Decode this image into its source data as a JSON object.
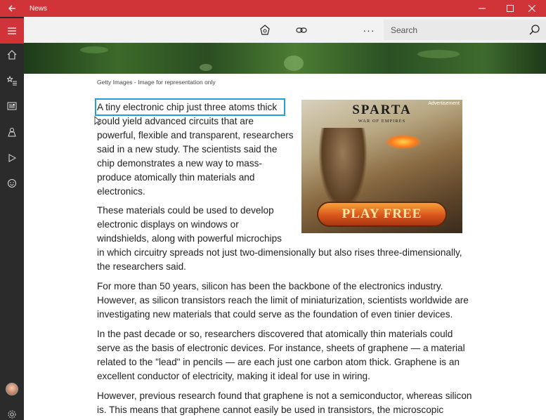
{
  "window": {
    "title": "News"
  },
  "toolbar": {
    "search_placeholder": "Search",
    "more_label": "···"
  },
  "icons": {
    "back": "back-arrow-icon",
    "minimize": "minimize-icon",
    "maximize": "maximize-icon",
    "close": "close-icon",
    "menu": "hamburger-icon",
    "home": "home-icon",
    "interests": "star-list-icon",
    "local": "newspaper-icon",
    "people": "person-icon",
    "video": "play-icon",
    "sports": "smiley-icon",
    "settings": "gear-icon",
    "save": "save-icon",
    "share": "link-icon",
    "night": "moon-icon",
    "search": "search-icon"
  },
  "colors": {
    "titlebar": "#d13438",
    "sidebar": "#2b2b2b",
    "highlight": "#1ea0dc"
  },
  "article": {
    "caption": "Getty Images - Image for representation only",
    "p1": [
      "A tiny electronic chip just three atoms thick",
      "could yield advanced circuits that are",
      "powerful, flexible and transparent, researchers",
      "said in a new study. The scientists said the",
      "chip demonstrates a new way to mass-",
      "produce atomically thin materials and",
      "electronics."
    ],
    "p2": [
      "These materials could be used to develop",
      "electronic displays on windows or",
      "windshields, along with powerful microchips",
      "in which circuitry spreads not just two-dimensionally but also rises three-dimensionally,",
      "the researchers said."
    ],
    "p3": [
      "For more than 50 years, silicon has been the backbone of the electronics industry.",
      "However, as silicon transistors reach the limit of miniaturization, scientists worldwide are",
      "investigating new materials that could serve as the foundation of even tinier devices."
    ],
    "p4": [
      "In the past decade or so, researchers discovered that atomically thin materials could",
      "serve as the basis of electronic devices. For instance, sheets of graphene — a material",
      "related to the \"lead\" in pencils — are each just one carbon atom thick. Graphene is an",
      "excellent conductor of electricity, making it ideal for use in wiring."
    ],
    "p5": [
      "However, previous research found that graphene is not a semiconductor, whereas silicon",
      "is. This means that graphene cannot easily be used in transistors, the microscopic"
    ]
  },
  "ad": {
    "label": "Advertisement",
    "title": "SPARTA",
    "subtitle": "WAR OF EMPIRES",
    "cta": "PLAY FREE"
  }
}
